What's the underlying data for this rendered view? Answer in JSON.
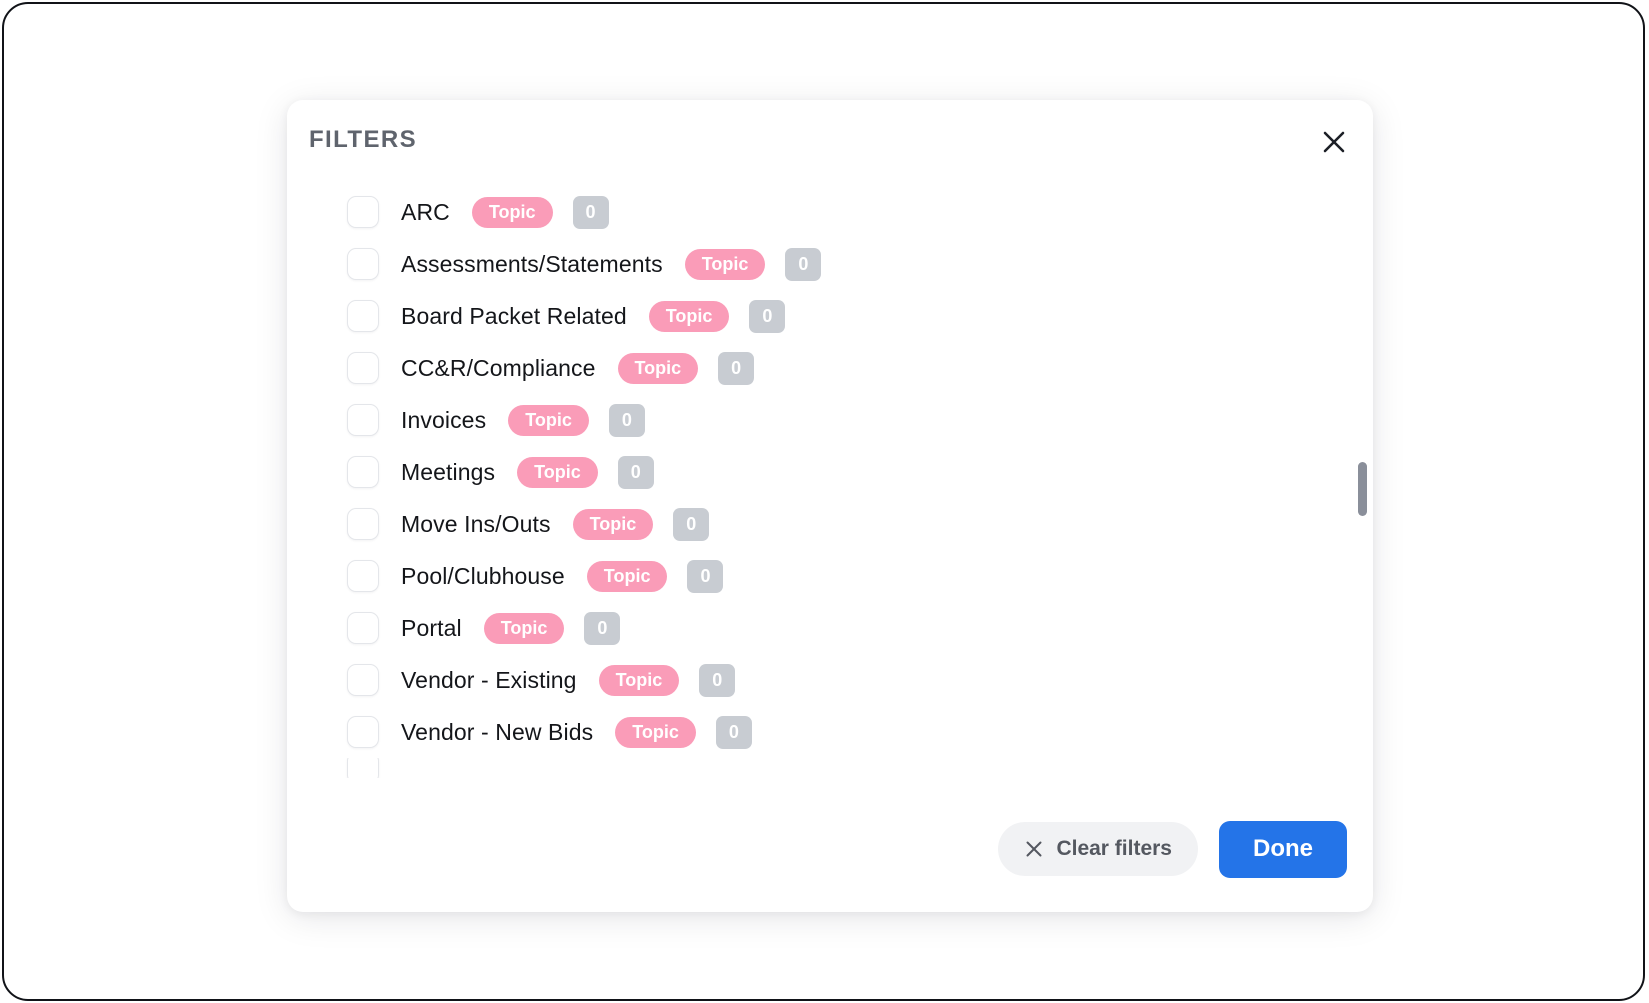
{
  "dialog": {
    "title": "FILTERS",
    "close_icon": "close-icon"
  },
  "filters": {
    "rows": [
      {
        "label": "ARC",
        "tag": "Topic",
        "count": "0",
        "checked": false
      },
      {
        "label": "Assessments/Statements",
        "tag": "Topic",
        "count": "0",
        "checked": false
      },
      {
        "label": "Board Packet Related",
        "tag": "Topic",
        "count": "0",
        "checked": false
      },
      {
        "label": "CC&R/Compliance",
        "tag": "Topic",
        "count": "0",
        "checked": false
      },
      {
        "label": "Invoices",
        "tag": "Topic",
        "count": "0",
        "checked": false
      },
      {
        "label": "Meetings",
        "tag": "Topic",
        "count": "0",
        "checked": false
      },
      {
        "label": "Move Ins/Outs",
        "tag": "Topic",
        "count": "0",
        "checked": false
      },
      {
        "label": "Pool/Clubhouse",
        "tag": "Topic",
        "count": "0",
        "checked": false
      },
      {
        "label": "Portal",
        "tag": "Topic",
        "count": "0",
        "checked": false
      },
      {
        "label": "Vendor - Existing",
        "tag": "Topic",
        "count": "0",
        "checked": false
      },
      {
        "label": "Vendor - New Bids",
        "tag": "Topic",
        "count": "0",
        "checked": false
      }
    ]
  },
  "footer": {
    "clear_label": "Clear filters",
    "clear_icon": "close-x-icon",
    "done_label": "Done"
  },
  "colors": {
    "tag_pink": "#FA9CB8",
    "count_gray": "#C8CCD2",
    "primary_blue": "#2474E8",
    "title_gray": "#5F646D",
    "scrollbar_thumb": "#8A8F9A"
  }
}
